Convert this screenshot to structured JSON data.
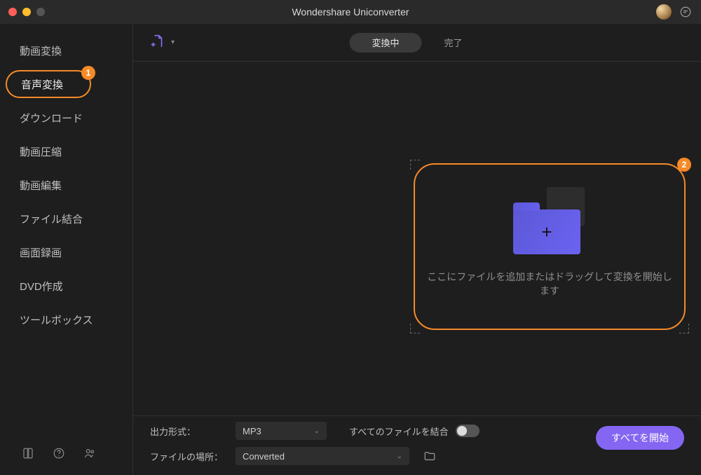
{
  "title": "Wondershare Uniconverter",
  "sidebar": {
    "items": [
      {
        "label": "動画変換"
      },
      {
        "label": "音声変換"
      },
      {
        "label": "ダウンロード"
      },
      {
        "label": "動画圧縮"
      },
      {
        "label": "動画編集"
      },
      {
        "label": "ファイル結合"
      },
      {
        "label": "画面録画"
      },
      {
        "label": "DVD作成"
      },
      {
        "label": "ツールボックス"
      }
    ]
  },
  "callouts": {
    "one": "1",
    "two": "2"
  },
  "tabs": {
    "converting": "変換中",
    "done": "完了"
  },
  "dropzone": {
    "text": "ここにファイルを追加またはドラッグして変換を開始します",
    "plus": "+"
  },
  "bottom": {
    "format_label": "出力形式：",
    "format_value": "MP3",
    "merge_label": "すべてのファイルを結合",
    "location_label": "ファイルの場所：",
    "location_value": "Converted",
    "start_all": "すべてを開始"
  }
}
